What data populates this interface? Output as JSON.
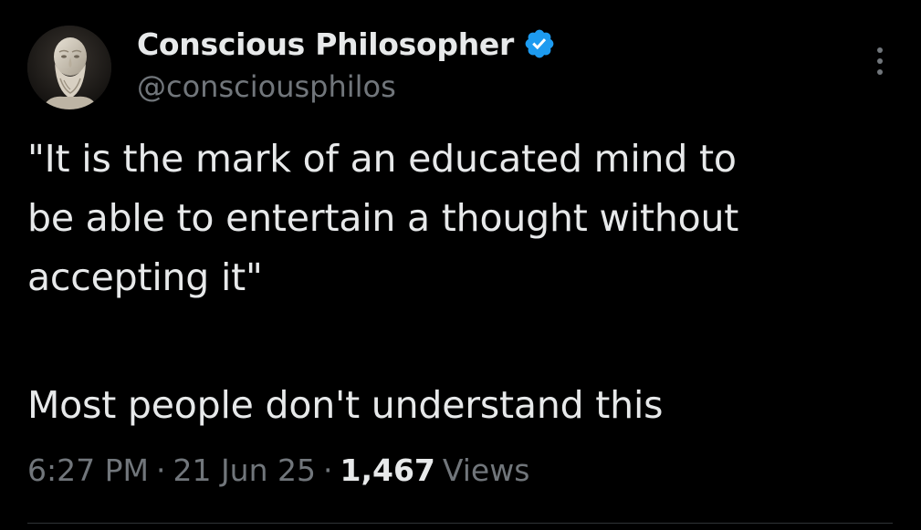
{
  "author": {
    "display_name": "Conscious Philosopher",
    "handle": "@consciousphilos",
    "verified_icon": "verified-badge-icon",
    "avatar_icon": "socrates-bust-avatar"
  },
  "tweet": {
    "lines": [
      "\"It is the mark of an educated mind to",
      "be able to entertain a thought without",
      "accepting it\"",
      "Most people don't understand this"
    ]
  },
  "meta": {
    "time": "6:27 PM",
    "separator": "·",
    "date": "21 Jun 25",
    "views_count": "1,467",
    "views_label": "Views"
  },
  "colors": {
    "background": "#000000",
    "text_primary": "#e7e9ea",
    "text_secondary": "#71767b",
    "verified_blue": "#1d9bf0"
  },
  "icons": {
    "more": "more-options-icon"
  }
}
